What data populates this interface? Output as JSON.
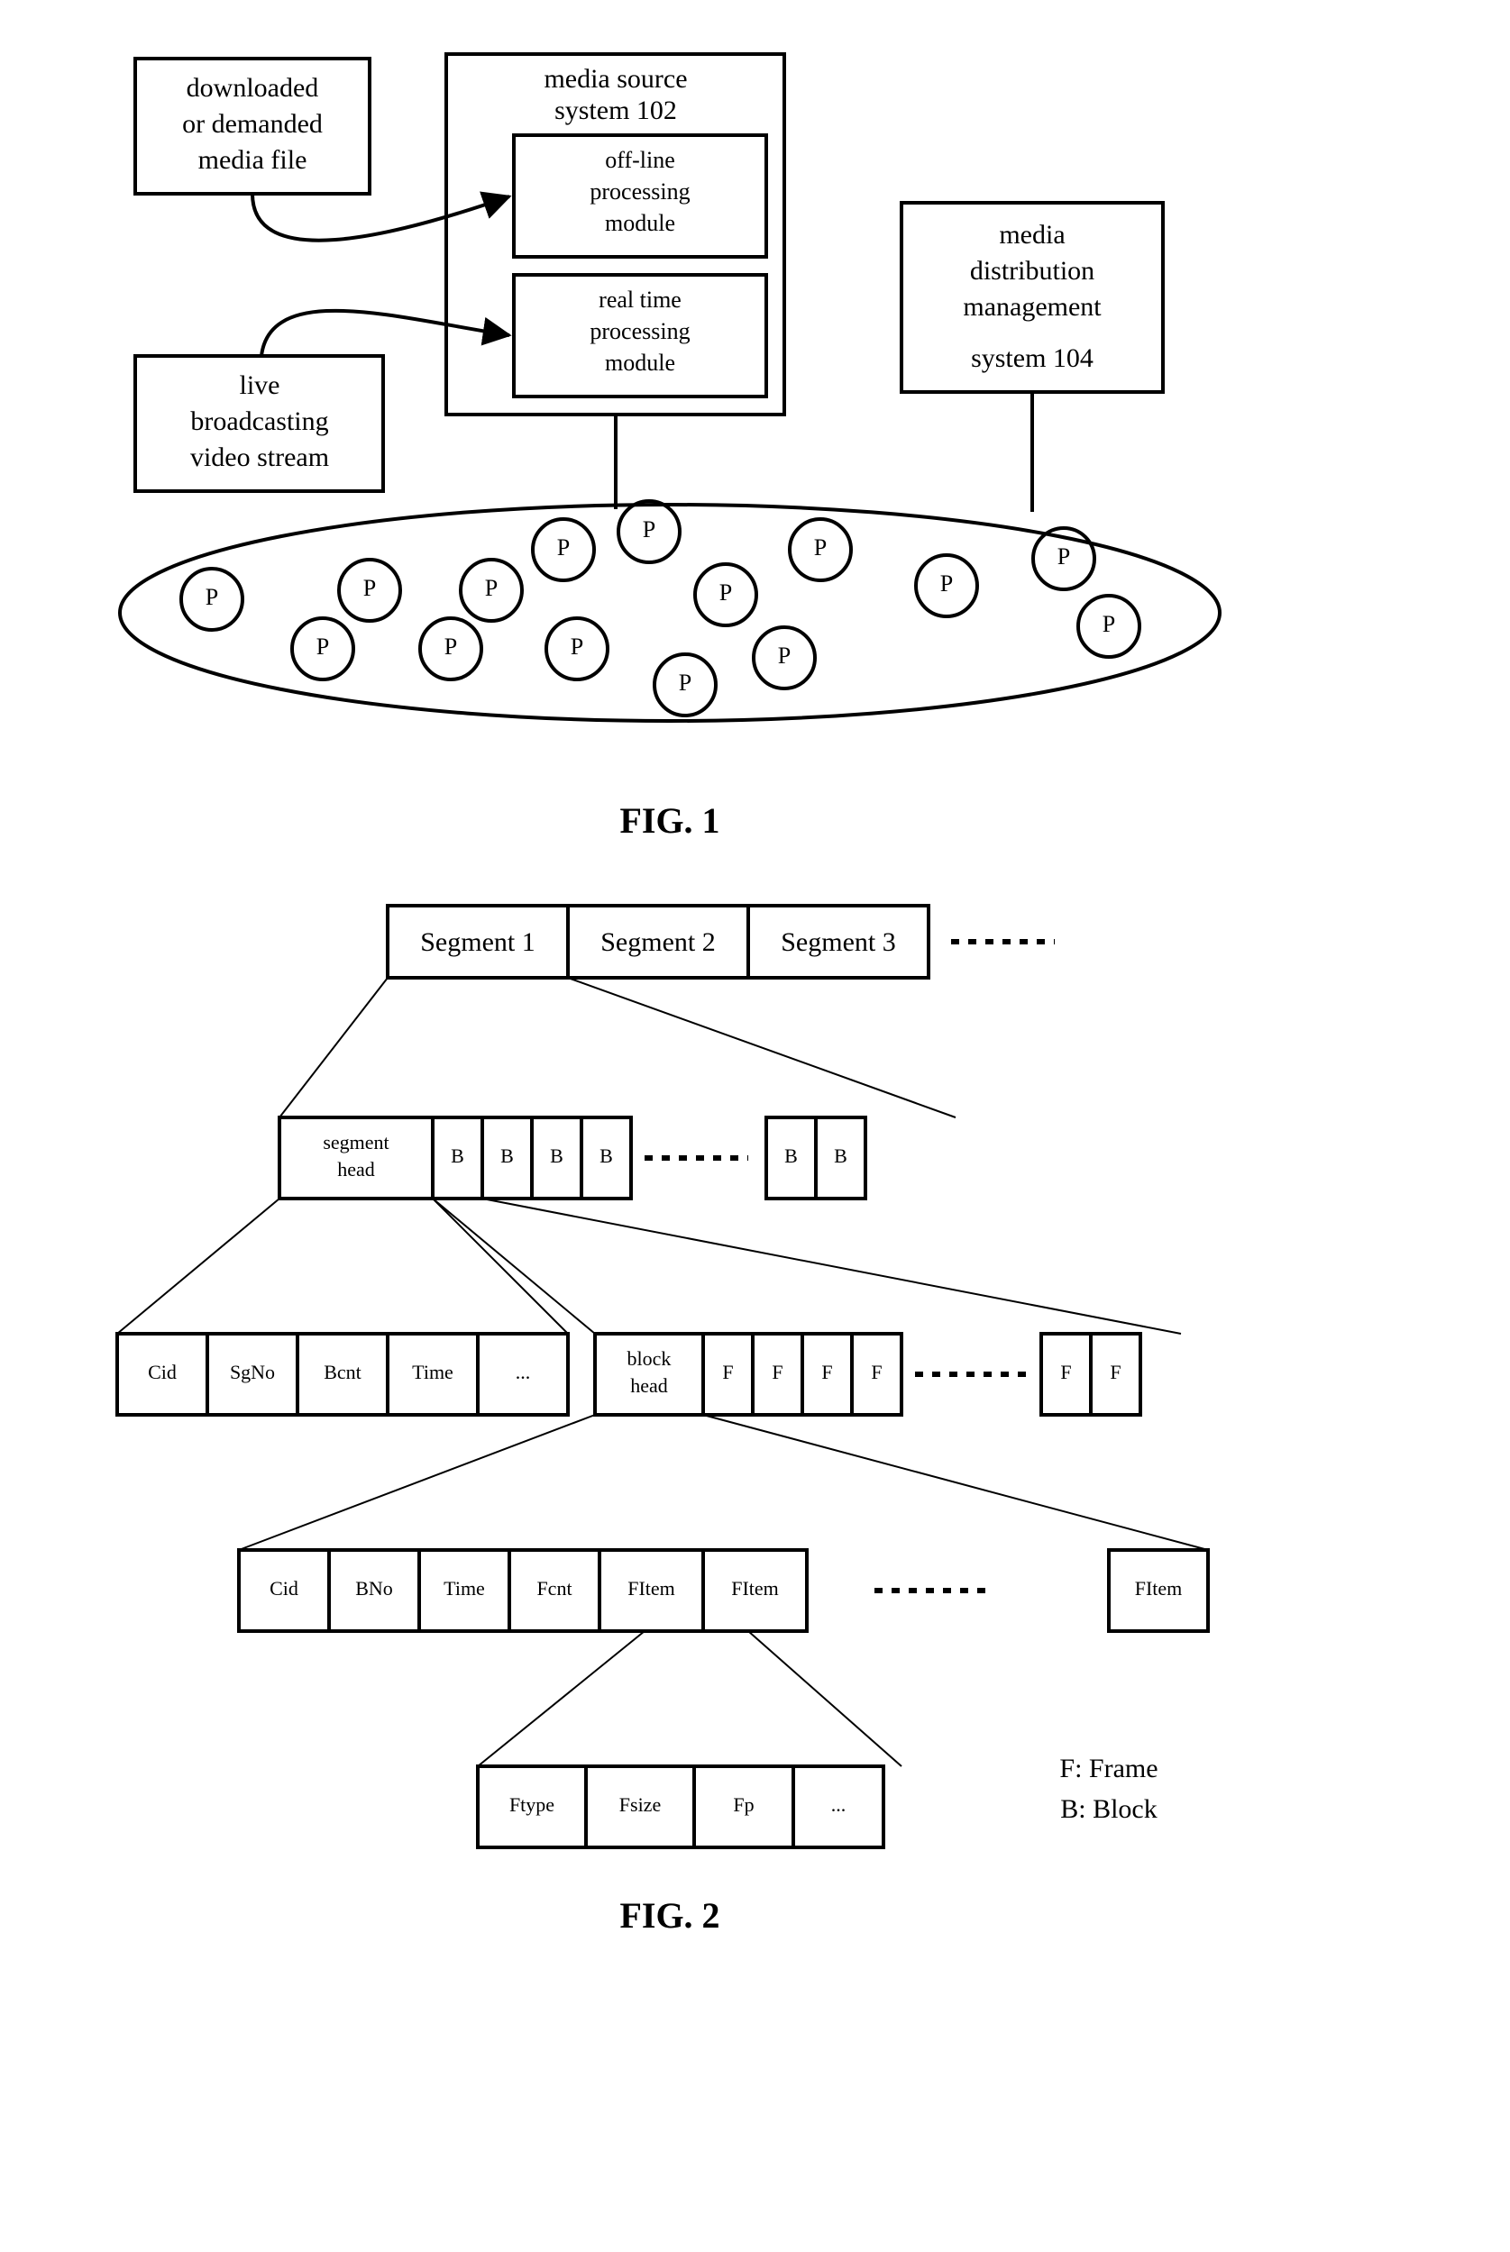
{
  "fig1": {
    "label": "FIG. 1",
    "downloaded": [
      "downloaded",
      "or demanded",
      "media file"
    ],
    "sourceTitle": [
      "media source",
      "system 102"
    ],
    "offline": [
      "off-line",
      "processing",
      "module"
    ],
    "realtime": [
      "real time",
      "processing",
      "module"
    ],
    "live": [
      "live",
      "broadcasting",
      "video stream"
    ],
    "mdms": [
      "media",
      "distribution",
      "management",
      "system    104"
    ],
    "peer": "P"
  },
  "fig2": {
    "label": "FIG. 2",
    "segments": [
      "Segment 1",
      "Segment 2",
      "Segment 3"
    ],
    "segHead": [
      "segment",
      "head"
    ],
    "blkHead": [
      "block",
      "head"
    ],
    "segHeadFields": [
      "Cid",
      "SgNo",
      "Bcnt",
      "Time",
      "..."
    ],
    "blkHeadFields": [
      "Cid",
      "BNo",
      "Time",
      "Fcnt",
      "FItem",
      "FItem"
    ],
    "fitemLast": "FItem",
    "fitemFields": [
      "Ftype",
      "Fsize",
      "Fp",
      "..."
    ],
    "B": "B",
    "F": "F",
    "legend": [
      "F:  Frame",
      "B:  Block"
    ]
  },
  "chart_data": {
    "type": "table",
    "title": "Media segment/block/frame data-structure hierarchy (FIG. 2) and system architecture (FIG. 1)",
    "fig1_architecture": {
      "inputs": [
        {
          "label": "downloaded or demanded media file",
          "target": "off-line processing module"
        },
        {
          "label": "live broadcasting video stream",
          "target": "real time processing module"
        }
      ],
      "media_source_system": {
        "id": 102,
        "modules": [
          "off-line processing module",
          "real time processing module"
        ]
      },
      "media_distribution_management_system": {
        "id": 104
      },
      "peer_network": {
        "peer_count_shown": 15,
        "peer_label": "P"
      }
    },
    "fig2_structure": {
      "segments": [
        "Segment 1",
        "Segment 2",
        "Segment 3",
        "..."
      ],
      "segment_layout": [
        "segment head",
        "B",
        "B",
        "B",
        "B",
        "...",
        "B",
        "B"
      ],
      "segment_head_fields": [
        "Cid",
        "SgNo",
        "Bcnt",
        "Time",
        "..."
      ],
      "block_layout": [
        "block head",
        "F",
        "F",
        "F",
        "F",
        "...",
        "F",
        "F"
      ],
      "block_head_fields": [
        "Cid",
        "BNo",
        "Time",
        "Fcnt",
        "FItem",
        "FItem",
        "...",
        "FItem"
      ],
      "fitem_fields": [
        "Ftype",
        "Fsize",
        "Fp",
        "..."
      ],
      "legend": {
        "F": "Frame",
        "B": "Block"
      }
    }
  }
}
